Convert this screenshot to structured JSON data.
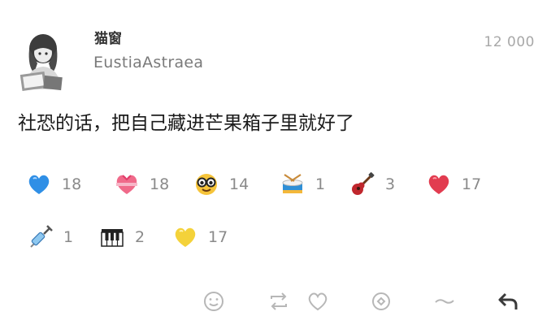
{
  "post": {
    "author_name": "猫窗",
    "author_handle": "EustiaAstraea",
    "time": "12 000",
    "text": "社恐的话，把自己藏进芒果箱子里就好了"
  },
  "reactions": [
    {
      "icon": "blue-heart-icon",
      "count": "18"
    },
    {
      "icon": "heart-with-ribbon-icon",
      "count": "18"
    },
    {
      "icon": "smiling-face-with-sunglasses-icon",
      "count": "14"
    },
    {
      "icon": "drum-icon",
      "count": "1"
    },
    {
      "icon": "guitar-icon",
      "count": "3"
    },
    {
      "icon": "red-heart-icon",
      "count": "17"
    },
    {
      "icon": "syringe-icon",
      "count": "1"
    },
    {
      "icon": "piano-keys-icon",
      "count": "2"
    },
    {
      "icon": "yellow-heart-icon",
      "count": "17"
    }
  ],
  "actions": [
    {
      "icon": "add-reaction-icon"
    },
    {
      "icon": "repost-icon"
    },
    {
      "icon": "like-icon"
    },
    {
      "icon": "quote-icon"
    },
    {
      "icon": "more-icon"
    },
    {
      "icon": "reply-icon"
    }
  ],
  "colors": {
    "text": "#1b1b1b",
    "muted": "#8a8a8a",
    "action_icon": "#b7b7b7",
    "reply_icon": "#3a3a3a",
    "blue_heart": "#2f8fe6",
    "red_heart": "#e23c50",
    "yellow_heart": "#f4d23a"
  }
}
